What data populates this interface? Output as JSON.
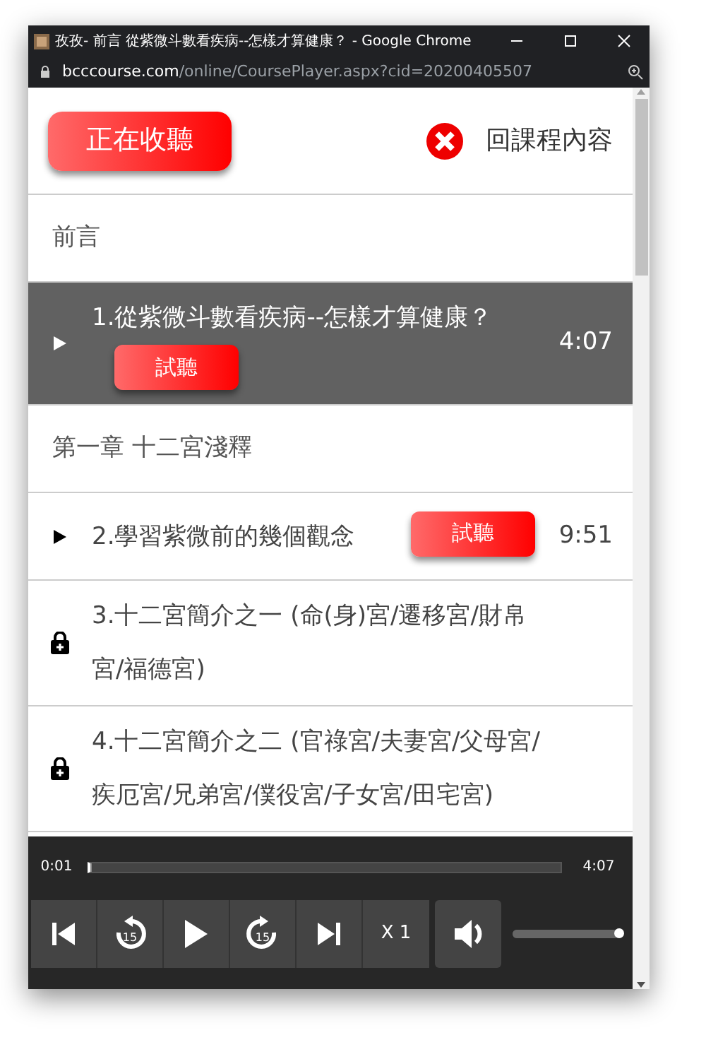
{
  "window": {
    "title": "孜孜- 前言 從紫微斗數看疾病--怎樣才算健康？ - Google Chrome",
    "url_domain": "bcccourse.com",
    "url_path": "/online/CoursePlayer.aspx?cid=20200405507"
  },
  "header": {
    "now_playing_button": "正在收聽",
    "back_link": "回課程內容"
  },
  "sections": [
    {
      "title": "前言",
      "lessons": [
        {
          "kind": "playable",
          "title": "1.從紫微斗數看疾病--怎樣才算健康？",
          "trial_button": "試聽",
          "duration": "4:07",
          "selected": true
        }
      ]
    },
    {
      "title": "第一章 十二宮淺釋",
      "lessons": [
        {
          "kind": "playable",
          "title": "2.學習紫微前的幾個觀念",
          "trial_button": "試聽",
          "duration": "9:51",
          "selected": false
        },
        {
          "kind": "locked",
          "title": "3.十二宮簡介之一 (命(身)宮/遷移宮/財帛宮/福德宮)",
          "selected": false
        },
        {
          "kind": "locked",
          "title": "4.十二宮簡介之二 (官祿宮/夫妻宮/父母宮/疾厄宮/兄弟宮/僕役宮/子女宮/田宅宮)",
          "selected": false
        }
      ]
    }
  ],
  "player": {
    "elapsed": "0:01",
    "total": "4:07",
    "progress": {
      "level": 0.004
    },
    "controls": [
      {
        "kind": "previous"
      },
      {
        "kind": "rewind",
        "label": "15"
      },
      {
        "kind": "play"
      },
      {
        "kind": "forward",
        "label": "15"
      },
      {
        "kind": "next"
      },
      {
        "kind": "speed",
        "label": "X 1"
      }
    ],
    "volume": {
      "level": 1
    }
  }
}
